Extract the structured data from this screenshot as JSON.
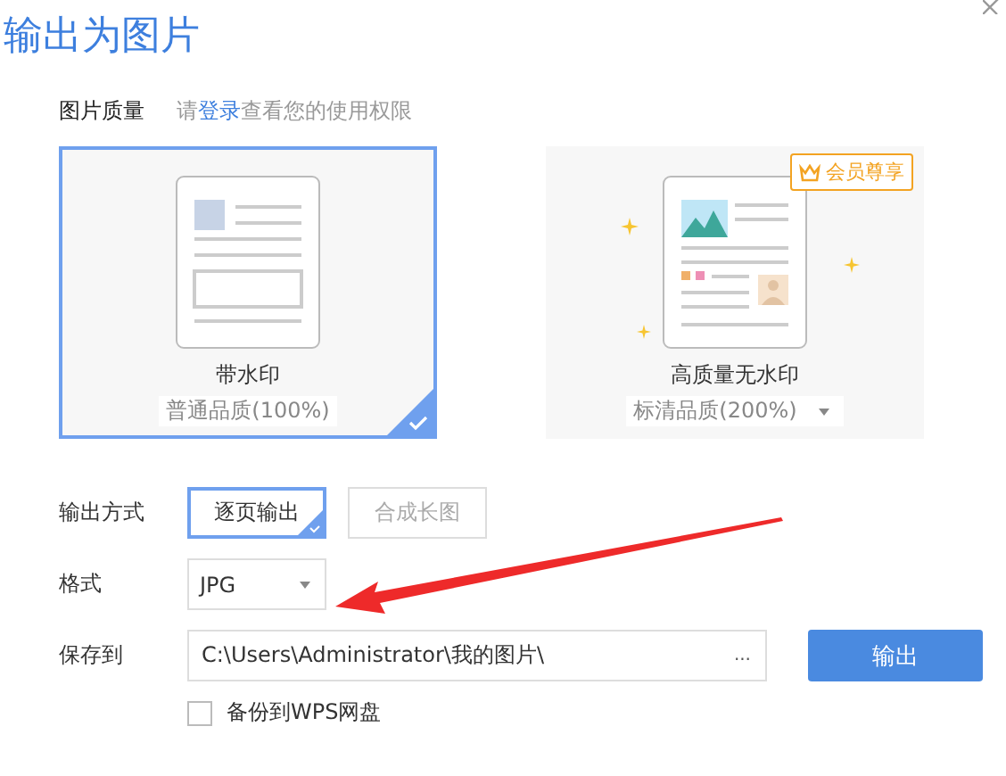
{
  "dialog": {
    "title": "输出为图片"
  },
  "quality": {
    "label": "图片质量",
    "hint": [
      {
        "kind": "text",
        "text": "请"
      },
      {
        "kind": "link",
        "text": "登录"
      },
      {
        "kind": "text",
        "text": "查看您的使用权限"
      }
    ],
    "options": [
      {
        "kind": "watermark",
        "title": "带水印",
        "subtitle": "普通品质(100%)",
        "selected": true
      },
      {
        "kind": "premium",
        "title": "高质量无水印",
        "subtitle": "标清品质(200%)",
        "selected": false,
        "badge": "会员尊享",
        "dropdown": true
      }
    ]
  },
  "output_mode": {
    "label": "输出方式",
    "options": [
      {
        "label": "逐页输出",
        "selected": true
      },
      {
        "label": "合成长图",
        "selected": false
      }
    ]
  },
  "format": {
    "label": "格式",
    "value": "JPG"
  },
  "save": {
    "label": "保存到",
    "path": "C:\\Users\\Administrator\\我的图片\\",
    "browse": "..."
  },
  "backup": {
    "label": "备份到WPS网盘",
    "checked": false
  },
  "submit": "输出"
}
